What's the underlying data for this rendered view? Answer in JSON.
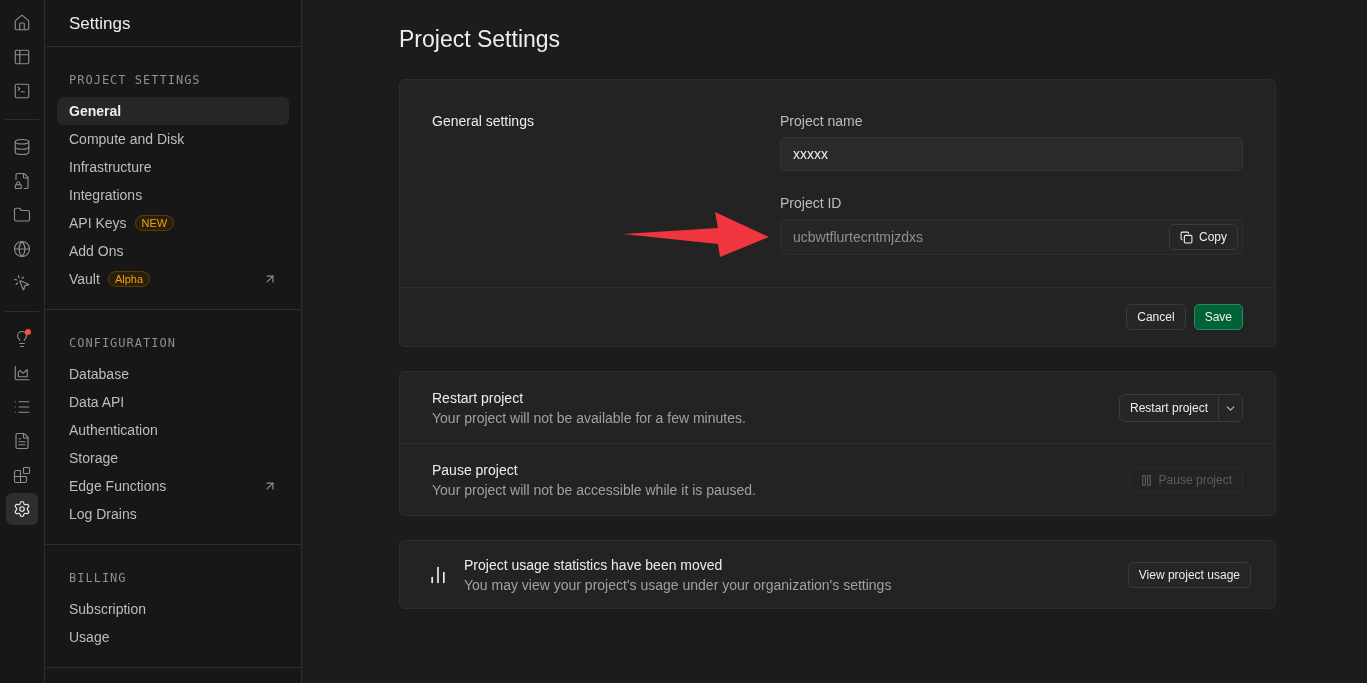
{
  "rail": {
    "groups": [
      [
        {
          "kind": "home",
          "selected": false
        },
        {
          "kind": "table",
          "selected": false
        },
        {
          "kind": "terminal",
          "selected": false
        }
      ],
      [
        {
          "kind": "database",
          "selected": false
        },
        {
          "kind": "lock",
          "selected": false
        },
        {
          "kind": "folder",
          "selected": false
        },
        {
          "kind": "globe",
          "selected": false
        },
        {
          "kind": "pointer",
          "selected": false
        }
      ],
      [
        {
          "kind": "lightbulb",
          "selected": false,
          "alert": true
        },
        {
          "kind": "chart",
          "selected": false,
          "alert": false
        },
        {
          "kind": "list",
          "selected": false,
          "alert": false
        },
        {
          "kind": "file",
          "selected": false,
          "alert": false
        },
        {
          "kind": "blocks",
          "selected": false,
          "alert": false
        },
        {
          "kind": "settings",
          "selected": true,
          "alert": false
        }
      ]
    ]
  },
  "sidebar": {
    "title": "Settings",
    "sections": [
      {
        "heading": "PROJECT SETTINGS",
        "items": [
          {
            "label": "General",
            "selected": true
          },
          {
            "label": "Compute and Disk",
            "selected": false
          },
          {
            "label": "Infrastructure",
            "selected": false
          },
          {
            "label": "Integrations",
            "selected": false
          },
          {
            "label": "API Keys",
            "selected": false,
            "badge": "NEW"
          },
          {
            "label": "Add Ons",
            "selected": false
          },
          {
            "label": "Vault",
            "selected": false,
            "badge": "Alpha",
            "external": true
          }
        ]
      },
      {
        "heading": "CONFIGURATION",
        "items": [
          {
            "label": "Database",
            "selected": false
          },
          {
            "label": "Data API",
            "selected": false
          },
          {
            "label": "Authentication",
            "selected": false
          },
          {
            "label": "Storage",
            "selected": false
          },
          {
            "label": "Edge Functions",
            "selected": false,
            "external": true
          },
          {
            "label": "Log Drains",
            "selected": false
          }
        ]
      },
      {
        "heading": "BILLING",
        "items": [
          {
            "label": "Subscription",
            "selected": false
          },
          {
            "label": "Usage",
            "selected": false
          }
        ]
      }
    ]
  },
  "page": {
    "title": "Project Settings",
    "general": {
      "heading": "General settings",
      "name_label": "Project name",
      "name_value": "xxxxx",
      "id_label": "Project ID",
      "id_value": "ucbwtflurtecntmjzdxs",
      "copy": "Copy",
      "cancel": "Cancel",
      "save": "Save"
    },
    "actions": [
      {
        "title": "Restart project",
        "description": "Your project will not be available for a few minutes.",
        "button": "Restart project",
        "kind": "split",
        "disabled": false
      },
      {
        "title": "Pause project",
        "description": "Your project will not be accessible while it is paused.",
        "button": "Pause project",
        "kind": "pause",
        "disabled": true
      }
    ],
    "notice": {
      "title": "Project usage statistics have been moved",
      "description": "You may view your project's usage under your organization's settings",
      "button": "View project usage"
    }
  }
}
